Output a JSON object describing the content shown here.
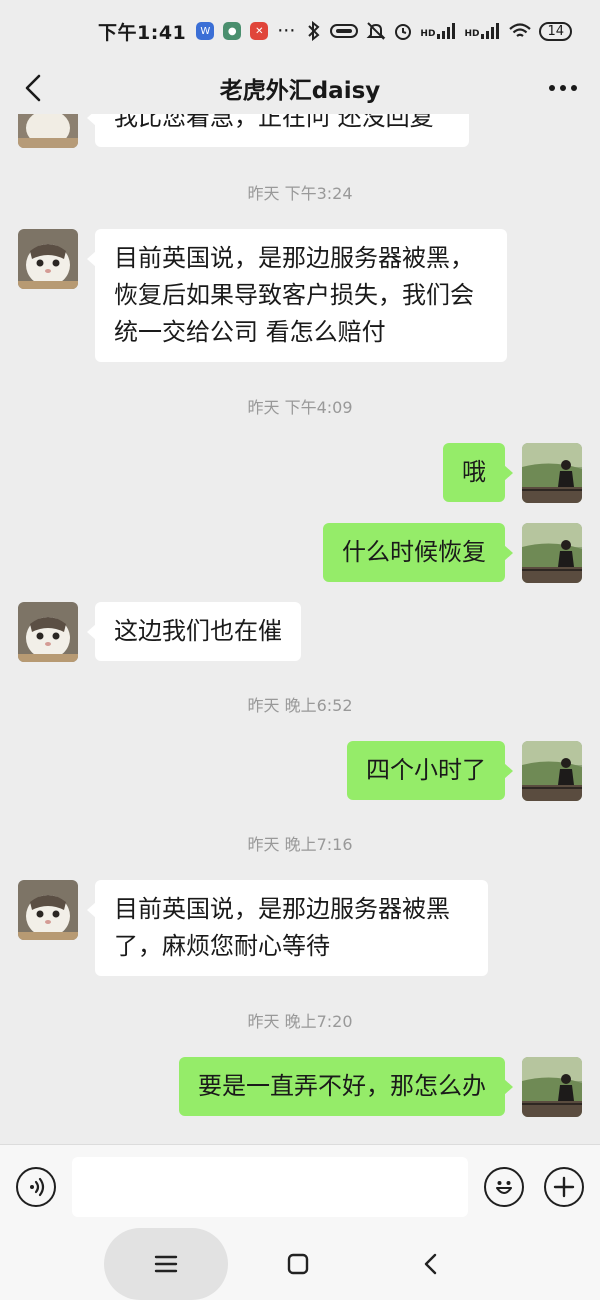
{
  "status_bar": {
    "time": "下午1:41",
    "overflow": "···",
    "signal_label_1": "HD",
    "signal_label_2": "HD",
    "battery": "14"
  },
  "header": {
    "title": "老虎外汇daisy"
  },
  "chat": {
    "clipped_message": "我比您着急，正在问 还没回复",
    "timestamps": [
      "昨天 下午3:24",
      "昨天 下午4:09",
      "昨天 晚上6:52",
      "昨天 晚上7:16",
      "昨天 晚上7:20"
    ],
    "messages": [
      {
        "side": "left",
        "text_lines": [
          "目前英国说，是那边服务器被黑，",
          "恢复后如果导致客户损失，我们会",
          "统一交给公司 看怎么赔付"
        ]
      },
      {
        "side": "right",
        "text": "哦"
      },
      {
        "side": "right",
        "text": "什么时候恢复"
      },
      {
        "side": "left",
        "text": "这边我们也在催"
      },
      {
        "side": "right",
        "text": "四个小时了"
      },
      {
        "side": "left",
        "text_lines": [
          "目前英国说，是那边服务器被黑",
          "了，麻烦您耐心等待"
        ]
      },
      {
        "side": "right",
        "text": "要是一直弄不好，那怎么办"
      }
    ]
  },
  "input_bar": {
    "placeholder": "",
    "voice_icon": "voice-icon",
    "emoji_icon": "emoji-icon",
    "add_icon": "plus-icon"
  },
  "colors": {
    "background": "#ededed",
    "bubble_self": "#95ec69",
    "bubble_other": "#ffffff",
    "timestamp": "#999999"
  }
}
